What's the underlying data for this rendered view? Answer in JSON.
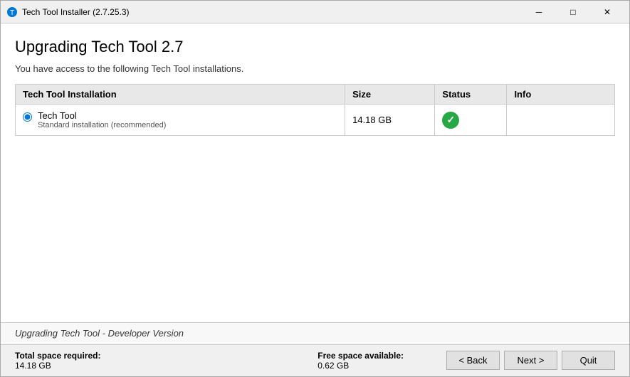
{
  "titleBar": {
    "icon": "⚙",
    "text": "Tech Tool Installer (2.7.25.3)",
    "minimizeLabel": "─",
    "maximizeLabel": "□",
    "closeLabel": "✕"
  },
  "page": {
    "title": "Upgrading Tech Tool 2.7",
    "subtitle": "You have access to the following Tech Tool installations."
  },
  "table": {
    "columns": [
      {
        "id": "installation",
        "label": "Tech Tool Installation"
      },
      {
        "id": "size",
        "label": "Size"
      },
      {
        "id": "status",
        "label": "Status"
      },
      {
        "id": "info",
        "label": "Info"
      }
    ],
    "rows": [
      {
        "name": "Tech Tool",
        "subtext": "Standard installation (recommended)",
        "size": "14.18 GB",
        "status": "ok",
        "info": ""
      }
    ]
  },
  "statusBar": {
    "text": "Upgrading Tech Tool - Developer Version"
  },
  "footer": {
    "totalSpaceLabel": "Total space required:",
    "totalSpaceValue": "14.18 GB",
    "freeSpaceLabel": "Free space available:",
    "freeSpaceValue": "0.62 GB",
    "backButton": "< Back",
    "nextButton": "Next >",
    "quitButton": "Quit"
  }
}
